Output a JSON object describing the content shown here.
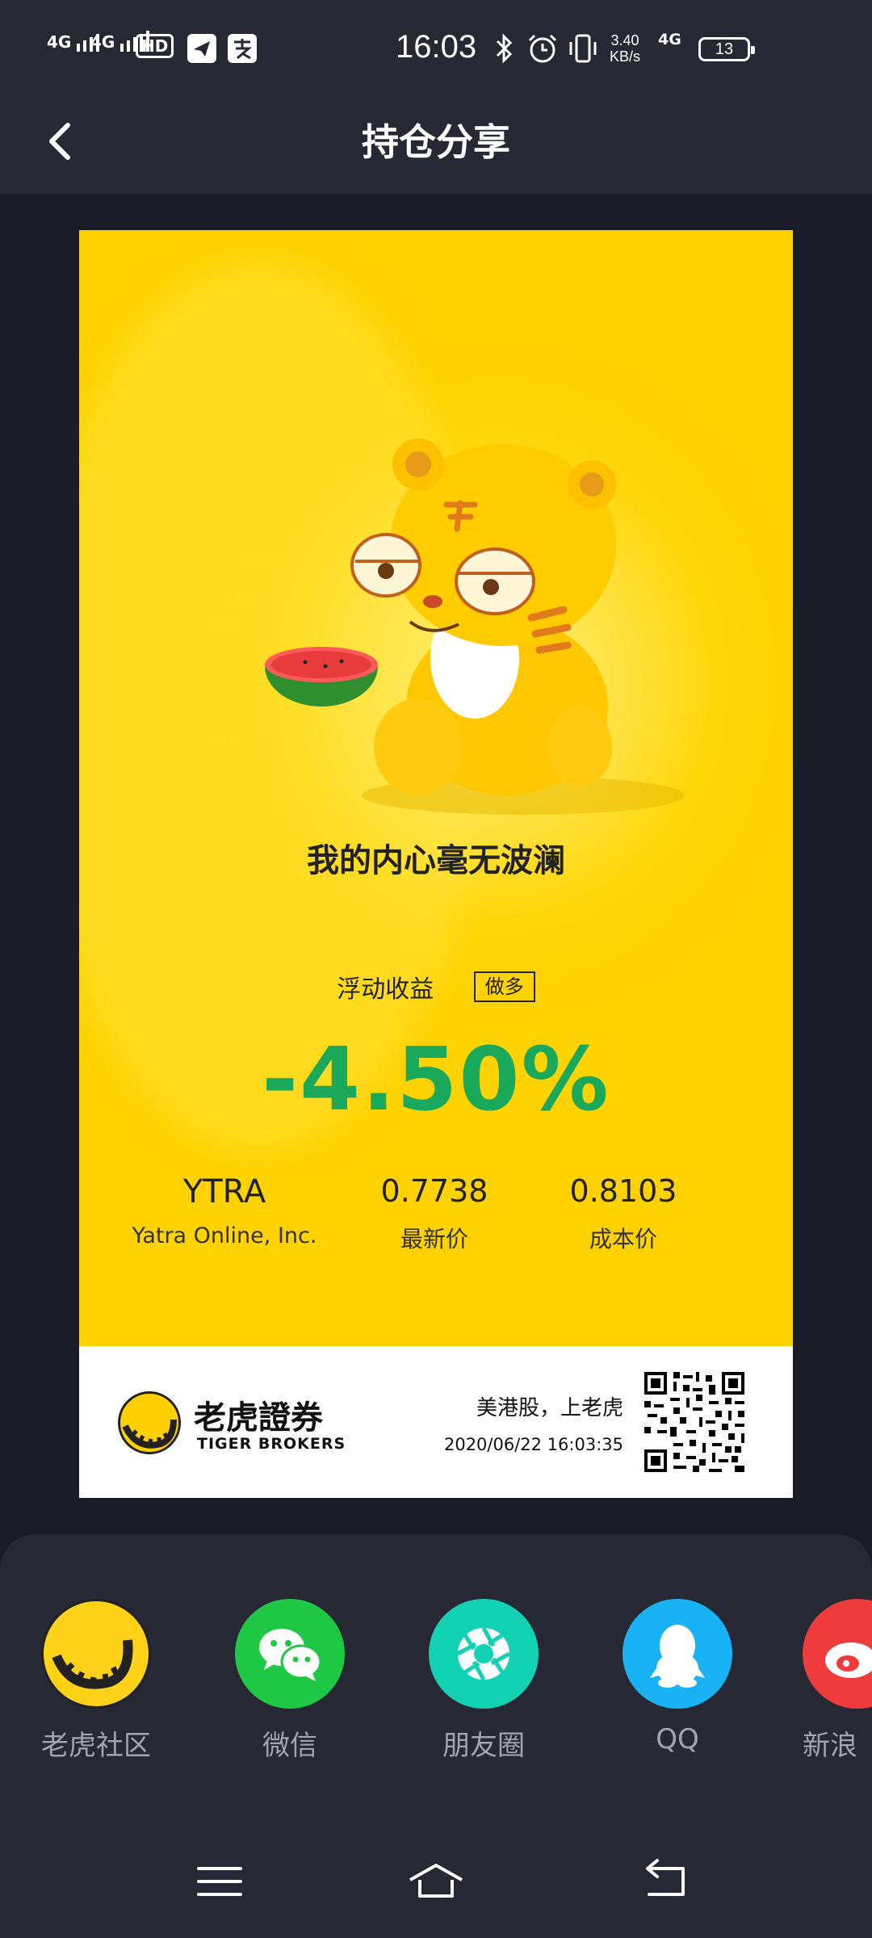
{
  "status_bar": {
    "signal1": "4G",
    "signal2": "4G",
    "hd": "HD",
    "time": "16:03",
    "net_speed_value": "3.40",
    "net_speed_unit": "KB/s",
    "net_type": "4G",
    "battery": "13"
  },
  "header": {
    "title": "持仓分享",
    "back_icon": "chevron-left-icon"
  },
  "poster": {
    "slogan": "我的内心毫无波澜",
    "pl_label": "浮动收益",
    "direction_badge": "做多",
    "pl_value": "-4.50%",
    "pl_color": "#1aa85a",
    "ticker": "YTRA",
    "company": "Yatra Online, Inc.",
    "last_price": "0.7738",
    "last_price_label": "最新价",
    "cost_price": "0.8103",
    "cost_price_label": "成本价"
  },
  "footer": {
    "brand_cn": "老虎證券",
    "brand_en": "TIGER BROKERS",
    "tagline": "美港股，上老虎",
    "timestamp": "2020/06/22 16:03:35"
  },
  "share_targets": [
    {
      "label": "老虎社区",
      "icon": "tiger-community-icon",
      "color": "#ffd21a"
    },
    {
      "label": "微信",
      "icon": "wechat-icon",
      "color": "#1ec845"
    },
    {
      "label": "朋友圈",
      "icon": "moments-icon",
      "color": "#13d2b4"
    },
    {
      "label": "QQ",
      "icon": "qq-icon",
      "color": "#19b3f5"
    },
    {
      "label": "新浪",
      "icon": "weibo-icon",
      "color": "#ef3b3b"
    }
  ],
  "nav": {
    "menu_icon": "menu-icon",
    "home_icon": "home-icon",
    "back_icon": "back-icon"
  }
}
